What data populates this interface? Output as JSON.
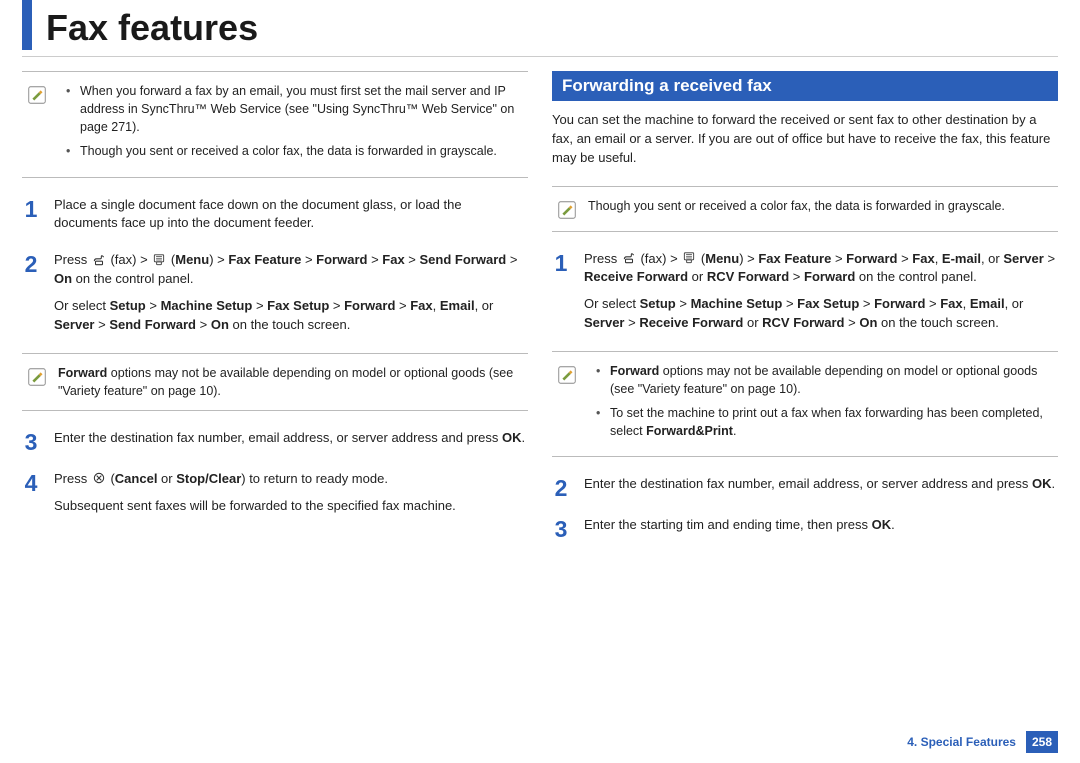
{
  "header": {
    "title": "Fax features"
  },
  "left": {
    "note1": {
      "items": [
        "When you forward a fax by an email, you must first set the mail server and IP address in SyncThru™ Web Service (see  \"Using SyncThru™ Web Service\" on page 271).",
        "Though you sent or received a color fax, the data is forwarded in grayscale."
      ]
    },
    "step1": {
      "num": "1",
      "text": "Place a single document face down on the document glass, or load the documents face up into the document feeder."
    },
    "step2": {
      "num": "2",
      "line1_a": "Press ",
      "line1_fax": " (fax) > ",
      "line1_menu_open": " (",
      "line1_menu": "Menu",
      "line1_b": ") > ",
      "line1_faxfeature": "Fax Feature",
      "line1_c": " > ",
      "line1_forward": "Forward",
      "line1_d": " > ",
      "line1_faxbold": "Fax",
      "line1_e": " > ",
      "line1_sendfwd": "Send Forward",
      "line1_f": " > ",
      "line1_on": "On",
      "line1_g": " on the control panel.",
      "line2_a": "Or select ",
      "line2_setup": "Setup",
      "line2_b": " > ",
      "line2_machine": "Machine Setup",
      "line2_c": " > ",
      "line2_faxsetup": "Fax Setup",
      "line2_d": " > ",
      "line2_forward": "Forward",
      "line2_e": " > ",
      "line2_fax": "Fax",
      "line2_f": ", ",
      "line2_email": "Email",
      "line2_g": ", or ",
      "line2_server": "Server",
      "line2_h": " > ",
      "line2_sendfwd": "Send Forward",
      "line2_i": " > ",
      "line2_on": "On",
      "line2_j": " on the touch screen."
    },
    "note2_a": "Forward",
    "note2_b": " options may not be available depending on model or optional goods (see \"Variety feature\" on page 10).",
    "step3": {
      "num": "3",
      "text_a": "Enter the destination fax number, email address, or server address and press ",
      "text_ok": "OK",
      "text_b": "."
    },
    "step4": {
      "num": "4",
      "line1_a": "Press ",
      "line1_b": "  (",
      "line1_cancel": "Cancel",
      "line1_c": " or ",
      "line1_stop": "Stop/Clear",
      "line1_d": ") to return to ready mode.",
      "line2": "Subsequent sent faxes will be forwarded to the specified fax machine."
    }
  },
  "right": {
    "heading": "Forwarding a received fax",
    "intro": "You can set the machine to forward the received or sent fax to other destination by a fax, an email or a server. If you are out of office but have to receive the fax, this feature may be useful.",
    "note1": "Though you sent or received a color fax, the data is forwarded in grayscale.",
    "step1": {
      "num": "1",
      "line1_a": "Press ",
      "line1_fax": " (fax) > ",
      "line1_menu_open": " (",
      "line1_menu": "Menu",
      "line1_b": ") > ",
      "line1_faxfeature": "Fax Feature",
      "line1_c": " > ",
      "line1_forward": "Forward",
      "line1_d": " > ",
      "line1_fax2": "Fax",
      "line1_e": ", ",
      "line1_email": "E-mail",
      "line1_f": ", or ",
      "line1_server": "Server",
      "line1_g": " > ",
      "line1_recvfwd": "Receive Forward",
      "line1_h": " or ",
      "line1_rcv": "RCV Forward",
      "line1_i": " > ",
      "line1_forward2": "Forward",
      "line1_j": " on the control panel.",
      "line2_a": "Or select ",
      "line2_setup": "Setup",
      "line2_b": " > ",
      "line2_machine": "Machine Setup",
      "line2_c": " > ",
      "line2_faxsetup": "Fax Setup",
      "line2_d": " > ",
      "line2_forward": "Forward",
      "line2_e": " > ",
      "line2_fax": "Fax",
      "line2_f": ", ",
      "line2_email": "Email",
      "line2_g": ", or ",
      "line2_server": "Server",
      "line2_h": " > ",
      "line2_recvfwd": "Receive Forward",
      "line2_i": " or ",
      "line2_rcv": "RCV Forward",
      "line2_j": " > ",
      "line2_on": "On",
      "line2_k": " on the touch screen."
    },
    "note2": {
      "item1_a": "Forward",
      "item1_b": " options may not be available depending on model or optional goods (see \"Variety feature\" on page 10).",
      "item2_a": "To set the machine to print out a fax when fax forwarding has been completed, select ",
      "item2_b": "Forward&Print",
      "item2_c": "."
    },
    "step2": {
      "num": "2",
      "text_a": "Enter the destination fax number, email address, or server address and press ",
      "text_ok": "OK",
      "text_b": "."
    },
    "step3": {
      "num": "3",
      "text_a": "Enter the starting tim and ending time, then press ",
      "text_ok": "OK",
      "text_b": "."
    }
  },
  "footer": {
    "chapter": "4.  Special Features",
    "page": "258"
  }
}
